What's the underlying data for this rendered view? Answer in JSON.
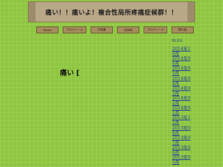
{
  "banner": {
    "title": "痛い！！痛いよ！複合性局所疼痛症候群！！"
  },
  "nav": {
    "items": [
      "Home",
      "プロフィール",
      "写真集",
      "HOME",
      "プロフィール",
      "掲示板"
    ]
  },
  "main": {
    "text": "痛い ["
  },
  "sidebar": {
    "label": "BLOG",
    "archives": [
      "2014年10月",
      "2014年06月",
      "2014年05月",
      "2014年04月",
      "2014年03月",
      "2014年02月",
      "2014年01月",
      "2013年12月",
      "2013年08月",
      "2013年07月",
      "2013年06月",
      "2013年05月"
    ]
  }
}
